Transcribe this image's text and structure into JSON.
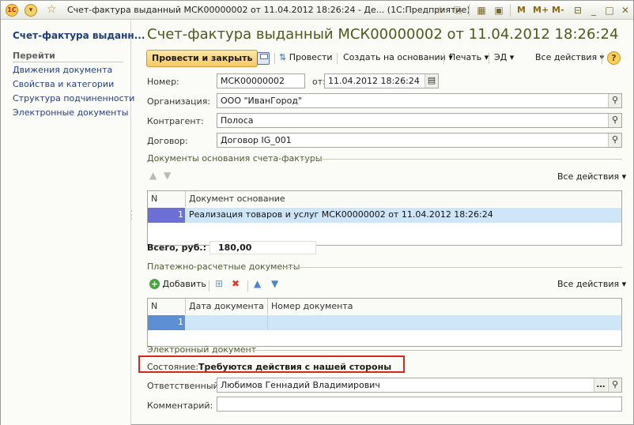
{
  "window": {
    "title": "Счет-фактура выданный МСК00000002 от 11.04.2012 18:26:24 - Де... (1С:Предприятие)",
    "logo_text": "1С",
    "btn_m": "M",
    "btn_mplus": "M+",
    "btn_mminus": "M-"
  },
  "sidebar": {
    "title": "Счет-фактура выданн...",
    "section": "Перейти",
    "items": [
      "Движения документа",
      "Свойства и категории",
      "Структура подчиненности",
      "Электронные документы"
    ]
  },
  "header": {
    "title": "Счет-фактура выданный МСК00000002 от 11.04.2012 18:26:24"
  },
  "toolbar": {
    "post_close": "Провести и закрыть",
    "post": "Провести",
    "create_based": "Создать на основании",
    "print": "Печать",
    "ed": "ЭД",
    "all_actions": "Все действия",
    "help": "?"
  },
  "form": {
    "number_label": "Номер:",
    "number_value": "МСК00000002",
    "date_label": "от:",
    "date_value": "11.04.2012 18:26:24",
    "org_label": "Организация:",
    "org_value": "ООО \"ИванГород\"",
    "contragent_label": "Контрагент:",
    "contragent_value": "Полоса",
    "contract_label": "Договор:",
    "contract_value": "Договор IG_001"
  },
  "base_docs": {
    "section": "Документы основания счета-фактуры",
    "all_actions": "Все действия",
    "col_n": "N",
    "col_doc": "Документ основание",
    "rows": [
      {
        "n": "1",
        "doc": "Реализация товаров и услуг МСК00000002 от 11.04.2012 18:26:24"
      }
    ]
  },
  "totals": {
    "label": "Всего, руб.:",
    "value": "180,00"
  },
  "payment_docs": {
    "section": "Платежно-расчетные документы",
    "add": "Добавить",
    "all_actions": "Все действия",
    "col_n": "N",
    "col_date": "Дата документа",
    "col_number": "Номер документа",
    "rows": [
      {
        "n": "1",
        "date": "",
        "number": ""
      }
    ]
  },
  "edoc": {
    "section": "Электронный документ",
    "state_label": "Состояние:",
    "state_value": "Требуются действия с нашей стороны",
    "resp_label": "Ответственный:",
    "resp_value": "Любимов Геннадий Владимирович",
    "comment_label": "Комментарий:",
    "comment_value": ""
  },
  "colors": {
    "accent_button": "#f6c965",
    "highlight_box": "#d9261c",
    "selected_row": "#cfe6f8"
  }
}
